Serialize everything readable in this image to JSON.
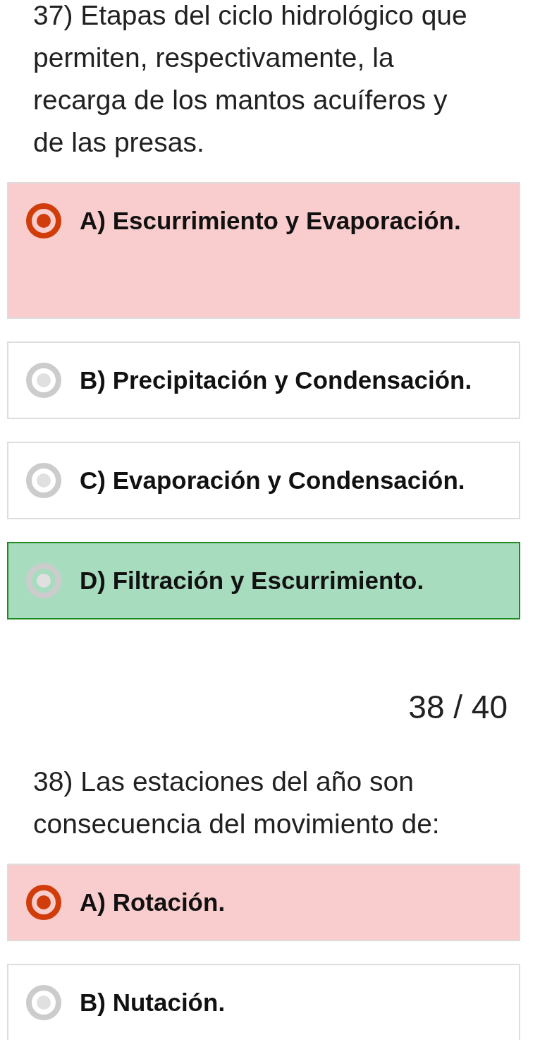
{
  "sections": [
    {
      "kind": "question",
      "text": "37) Etapas del ciclo hidrológico que permiten, respectivamente, la recarga de los mantos acuíferos y de las presas.",
      "options": [
        {
          "label": "A) Escurrimiento y Evaporación.",
          "selected": true,
          "correct": false
        },
        {
          "label": "B) Precipitación y Condensación.",
          "selected": false,
          "correct": false
        },
        {
          "label": "C) Evaporación y Condensación.",
          "selected": false,
          "correct": false
        },
        {
          "label": "D) Filtración y Escurrimiento.",
          "selected": false,
          "correct": true
        }
      ]
    },
    {
      "kind": "counter",
      "text": "38 / 40"
    },
    {
      "kind": "question",
      "text": "38) Las estaciones del año son consecuencia del movimiento de:",
      "options": [
        {
          "label": "A) Rotación.",
          "selected": true,
          "correct": false
        },
        {
          "label": "B) Nutación.",
          "selected": false,
          "correct": false
        }
      ]
    }
  ]
}
